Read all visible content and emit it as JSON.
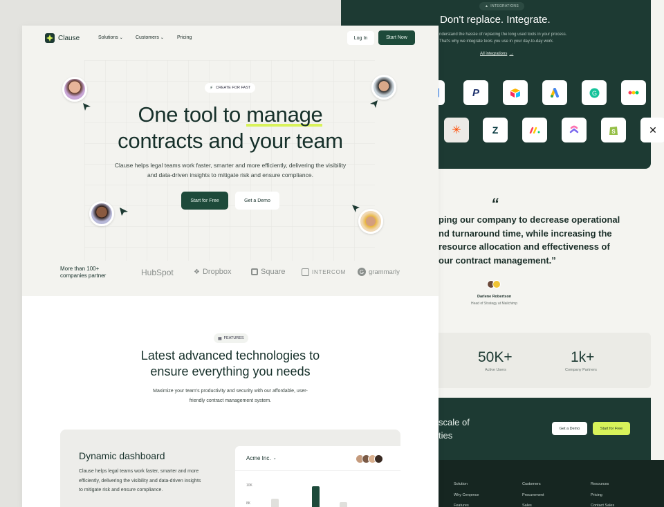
{
  "integrations": {
    "badge": "INTEGRATIONS",
    "title": "Don't replace. Integrate.",
    "desc_line1": "nderstand the hassle of replacing the long used tools in your process.",
    "desc_line2": "That's why we integrate tools you use in your day-to-day work.",
    "link": "All integrations",
    "row1_icons": [
      "trello-icon",
      "paypal-icon",
      "airtable-icon",
      "google-ads-icon",
      "grammarly-icon",
      "monday-icon"
    ],
    "row2_icons": [
      "zapier-icon",
      "zendesk-icon",
      "monday-board-icon",
      "clickup-icon",
      "shopify-icon",
      "x-icon"
    ]
  },
  "testimonial": {
    "quote_mark": "“",
    "line1": "ping our company to decrease operational",
    "line2": "nd turnaround time, while increasing the",
    "line3": "resource allocation and effectiveness of",
    "line4": "our contract management.”",
    "name": "Darlene Robertson",
    "role": "Head of Strategy at Mailchimp"
  },
  "stats": [
    {
      "value": "50K+",
      "label": "Active Users"
    },
    {
      "value": "1k+",
      "label": "Company Partners"
    }
  ],
  "cta_band": {
    "line1": "scale of",
    "line2": "ties",
    "demo": "Get a Demo",
    "start": "Start for Free"
  },
  "footer": {
    "col1": [
      "Solution",
      "Why Cerqence",
      "Features"
    ],
    "col2": [
      "Customers",
      "Procurement",
      "Sales"
    ],
    "col3": [
      "Resources",
      "Pricing",
      "Contact Sales"
    ]
  },
  "nav": {
    "brand": "Clause",
    "solutions": "Solutions",
    "customers": "Customers",
    "pricing": "Pricing",
    "login": "Log In",
    "start": "Start Now"
  },
  "hero": {
    "badge": "CREATE FOR FAST",
    "title_part1": "One tool to ",
    "title_highlight": "manage",
    "title_line2": "contracts and your team",
    "sub_line1": "Clause helps legal teams work faster, smarter and more efficiently, delivering the visibility",
    "sub_line2": "and data-driven insights to mitigate risk and ensure compliance.",
    "cta_primary": "Start for Free",
    "cta_secondary": "Get a Demo"
  },
  "partners": {
    "label_line1": "More than 100+",
    "label_line2": "companies partner",
    "logos": [
      "HubSpot",
      "Dropbox",
      "Square",
      "INTERCOM",
      "grammarly"
    ]
  },
  "features": {
    "badge": "FEATURES",
    "title_line1": "Latest advanced technologies to",
    "title_line2": "ensure everything you needs",
    "sub_line1": "Maximize your team's productivity and security with our affordable, user-",
    "sub_line2": "friendly contract management system."
  },
  "dashboard": {
    "title": "Dynamic dashboard",
    "desc_line1": "Clause helps legal teams work faster, smarter and more",
    "desc_line2": "efficiently, delivering the visibility and data-driven insights",
    "desc_line3": "to mitigate risk and ensure compliance.",
    "company": "Acme Inc.",
    "y_tick_top": "10K",
    "y_tick_mid": "8K"
  },
  "colors": {
    "brand_dark": "#1d3a33",
    "accent_lime": "#d8f25a",
    "bg": "#f3f3ef"
  }
}
